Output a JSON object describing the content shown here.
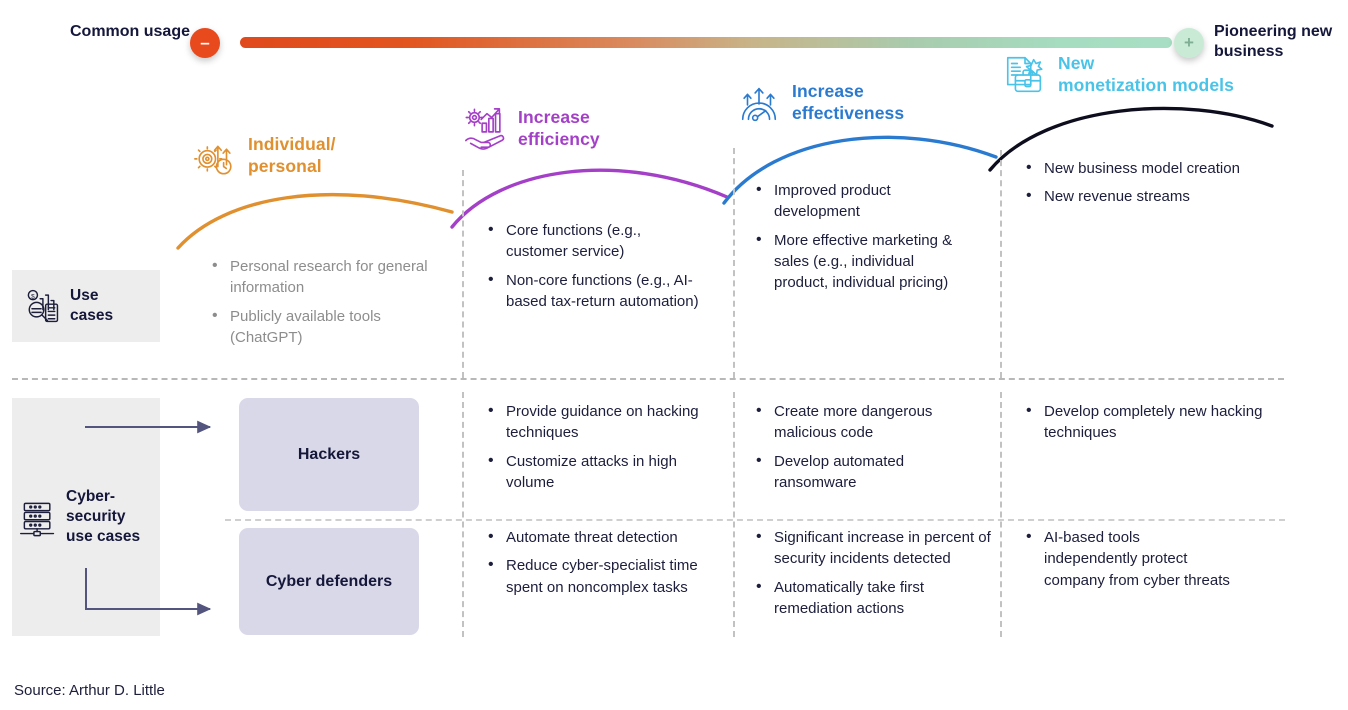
{
  "spectrum": {
    "left_label": "Common\nusage",
    "right_label": "Pioneering\nnew business",
    "minus_glyph": "–",
    "plus_glyph": "+",
    "gradient_start": "#e0491c",
    "gradient_end": "#a8dfc4"
  },
  "stages": [
    {
      "title": "Individual/\npersonal",
      "color": "#e0902f",
      "icon": "gear-arrows-clock-icon"
    },
    {
      "title": "Increase\nefficiency",
      "color": "#a43fc8",
      "icon": "hand-bar-chart-icon"
    },
    {
      "title": "Increase\neffectiveness",
      "color": "#2a7ad0",
      "icon": "arch-upward-arrows-icon"
    },
    {
      "title": "New\nmonetization models",
      "color": "#49c3e8",
      "icon": "briefcase-document-icon"
    }
  ],
  "rows": [
    {
      "label": "Use\ncases",
      "icon": "research-analysis-icon",
      "cells": [
        {
          "muted": true,
          "items": [
            "Personal research for general information",
            "Publicly available tools (ChatGPT)"
          ]
        },
        {
          "muted": false,
          "items": [
            "Core functions (e.g., customer service)",
            "Non-core functions (e.g., AI-based tax-return automation)"
          ]
        },
        {
          "muted": false,
          "items": [
            "Improved product development",
            "More effective marketing & sales (e.g., individual product, individual pricing)"
          ]
        },
        {
          "muted": false,
          "items": [
            "New business model creation",
            "New revenue streams"
          ]
        }
      ]
    },
    {
      "label": "Cyber-\nsecurity\nuse cases",
      "icon": "server-rack-icon",
      "actors": [
        {
          "name": "Hackers",
          "cells": [
            {
              "items": []
            },
            {
              "items": [
                "Provide guidance on hacking techniques",
                "Customize attacks in high volume"
              ]
            },
            {
              "items": [
                "Create more dangerous malicious code",
                "Develop automated ransomware"
              ]
            },
            {
              "items": [
                "Develop completely new hacking techniques"
              ]
            }
          ]
        },
        {
          "name": "Cyber defenders",
          "cells": [
            {
              "items": []
            },
            {
              "items": [
                "Automate threat detection",
                "Reduce cyber-specialist time spent on noncomplex tasks"
              ]
            },
            {
              "items": [
                "Significant increase in percent of security incidents detected",
                "Automatically take first remediation actions"
              ]
            },
            {
              "items": [
                "AI-based tools independently protect company from cyber threats"
              ]
            }
          ]
        }
      ]
    }
  ],
  "source": "Source: Arthur D. Little"
}
